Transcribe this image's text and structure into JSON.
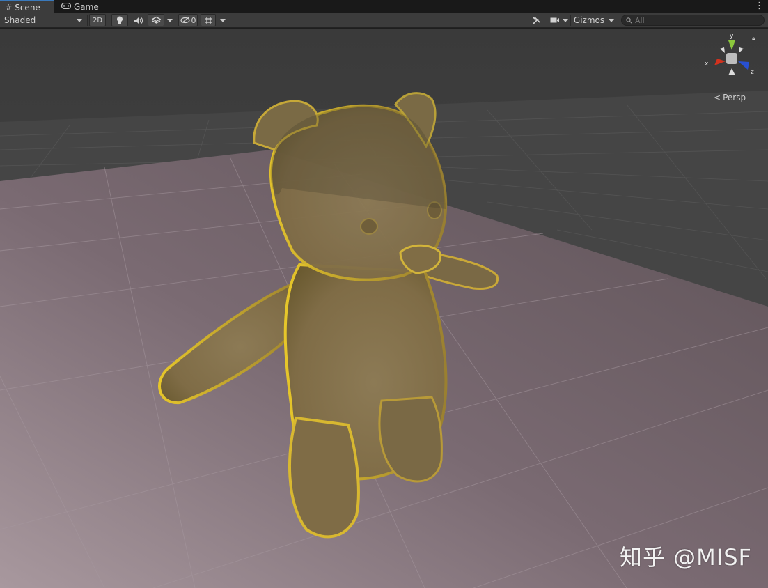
{
  "tabs": [
    {
      "label": "Scene",
      "icon": "grid-icon",
      "active": true
    },
    {
      "label": "Game",
      "icon": "gamepad-icon",
      "active": false
    }
  ],
  "toolbar": {
    "draw_mode": "Shaded",
    "mode_2d": "2D",
    "hidden_count": "0",
    "gizmos_label": "Gizmos",
    "search_placeholder": "All"
  },
  "orientation_gizmo": {
    "axis_x": "x",
    "axis_y": "y",
    "axis_z": "z",
    "projection_label": "Persp",
    "colors": {
      "x": "#d2321e",
      "y": "#8cc83c",
      "z": "#2850d2"
    }
  },
  "watermark": "知乎 @MISF",
  "colors": {
    "tab_accent": "#3a79bb",
    "toolbar_bg": "#3c3c3c",
    "bear_gold": "#b49a3c",
    "ground_plane": "#7a6a72"
  }
}
